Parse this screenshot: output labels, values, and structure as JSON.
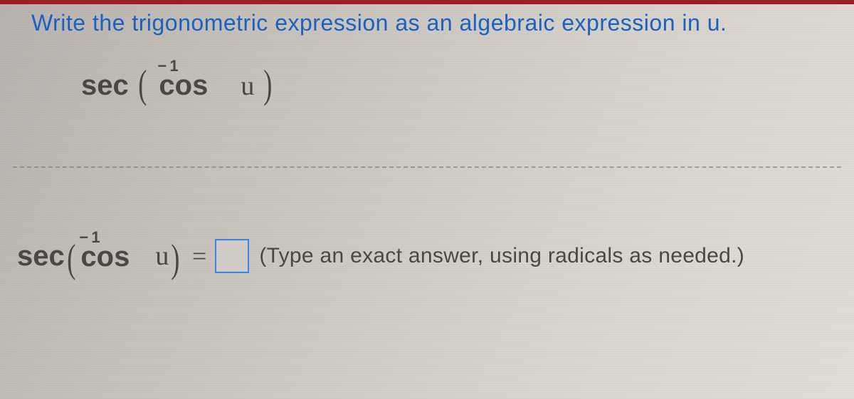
{
  "prompt": "Write the trigonometric expression as an algebraic expression in u.",
  "math": {
    "sec": "sec",
    "cos": "cos",
    "inv_exp": "− 1",
    "var": "u",
    "lparen": "(",
    "rparen": ")",
    "equals": "="
  },
  "hint": "(Type an exact answer, using radicals as needed.)"
}
